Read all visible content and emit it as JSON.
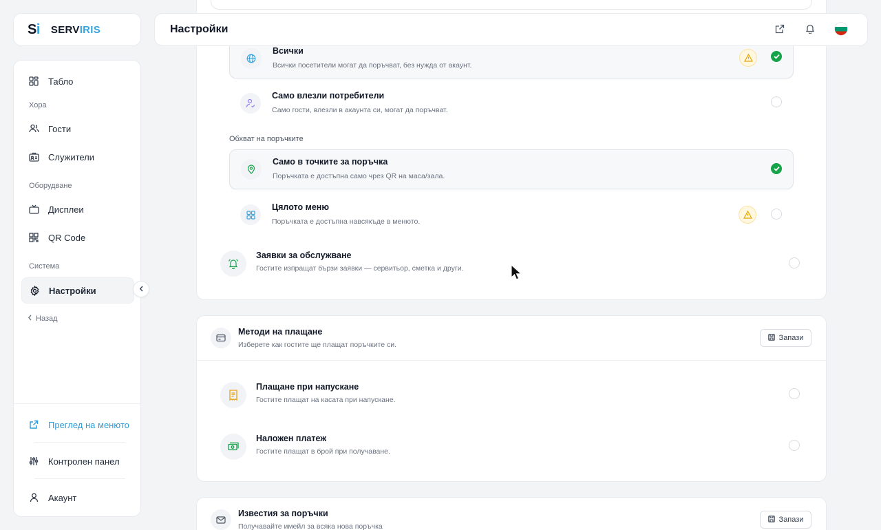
{
  "brand": {
    "mark_s": "S",
    "mark_i": "i",
    "name_a": "SERV",
    "name_b": "IRIS",
    "accent": "#38a5e0"
  },
  "header": {
    "title": "Настройки"
  },
  "sidebar": {
    "dashboard": "Табло",
    "section_people": "Хора",
    "guests": "Гости",
    "staff": "Служители",
    "section_equipment": "Оборудване",
    "displays": "Дисплеи",
    "qr": "QR Code",
    "section_system": "Система",
    "settings": "Настройки",
    "back": "Назад",
    "preview_menu": "Преглед на менюто",
    "control_panel": "Контролен панел",
    "account": "Акаунт"
  },
  "ordering": {
    "who": [
      {
        "title": "Всички",
        "desc": "Всички посетители могат да поръчват, без нужда от акаунт.",
        "selected": true,
        "warning": true
      },
      {
        "title": "Само влезли потребители",
        "desc": "Само гости, влезли в акаунта си, могат да поръчват.",
        "selected": false,
        "warning": false
      }
    ],
    "scope_label": "Обхват на поръчките",
    "scope": [
      {
        "title": "Само в точките за поръчка",
        "desc": "Поръчката е достъпна само чрез QR на маса/зала.",
        "selected": true,
        "warning": false
      },
      {
        "title": "Цялото меню",
        "desc": "Поръчката е достъпна навсякъде в менюто.",
        "selected": false,
        "warning": true
      }
    ],
    "service_requests": {
      "title": "Заявки за обслужване",
      "desc": "Гостите изпращат бързи заявки — сервитьор, сметка и други.",
      "enabled": false
    }
  },
  "payments": {
    "title": "Методи на плащане",
    "desc": "Изберете как гостите ще плащат поръчките си.",
    "save": "Запази",
    "methods": [
      {
        "title": "Плащане при напускане",
        "desc": "Гостите плащат на касата при напускане.",
        "icon": "receipt-icon",
        "color": "#e8a317"
      },
      {
        "title": "Наложен платеж",
        "desc": "Гостите плащат в брой при получаване.",
        "icon": "cash-icon",
        "color": "#16a34a"
      }
    ]
  },
  "notifications": {
    "title": "Известия за поръчки",
    "desc": "Получавайте имейл за всяка нова поръчка",
    "save": "Запази"
  },
  "colors": {
    "selected": "#16a34a",
    "warning": "#f5b700",
    "link": "#2f9bd8"
  }
}
